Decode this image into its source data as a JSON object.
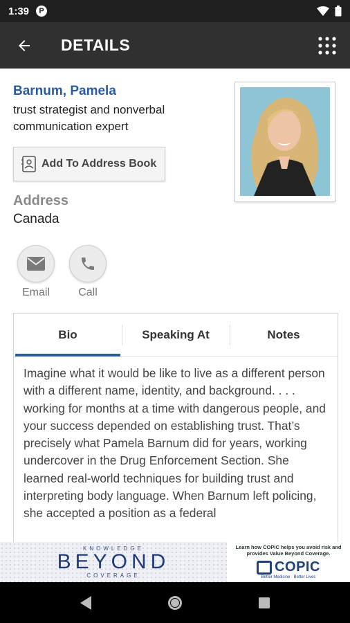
{
  "status": {
    "time": "1:39",
    "notification_glyph": "P"
  },
  "app_bar": {
    "title": "DETAILS"
  },
  "profile": {
    "name": "Barnum, Pamela",
    "role": "trust strategist and nonverbal communication expert"
  },
  "address_book_button": "Add To Address Book",
  "address": {
    "label": "Address",
    "value": "Canada"
  },
  "actions": {
    "email": "Email",
    "call": "Call"
  },
  "tabs": [
    {
      "label": "Bio",
      "active": true
    },
    {
      "label": "Speaking At",
      "active": false
    },
    {
      "label": "Notes",
      "active": false
    }
  ],
  "bio": "Imagine what it would be like to live as a different person with a different name, identity, and background. . . . working for months at a time with dangerous people, and your success depended on establishing trust. That’s precisely what Pamela Barnum did for years, working undercover in the Drug Enforcement Section. She learned real-world techniques for building trust and interpreting body language. When Barnum left policing, she accepted a position as a federal",
  "ad": {
    "top_word": "KNOWLEDGE",
    "main_word": "BEYOND",
    "bottom_word": "COVERAGE",
    "right_text": "Learn how COPIC helps you avoid risk and provides Value Beyond Coverage.",
    "brand": "COPIC",
    "tagline": "Better Medicine · Better Lives"
  },
  "colors": {
    "accent": "#2a5aa0",
    "app_bar": "#303030"
  }
}
